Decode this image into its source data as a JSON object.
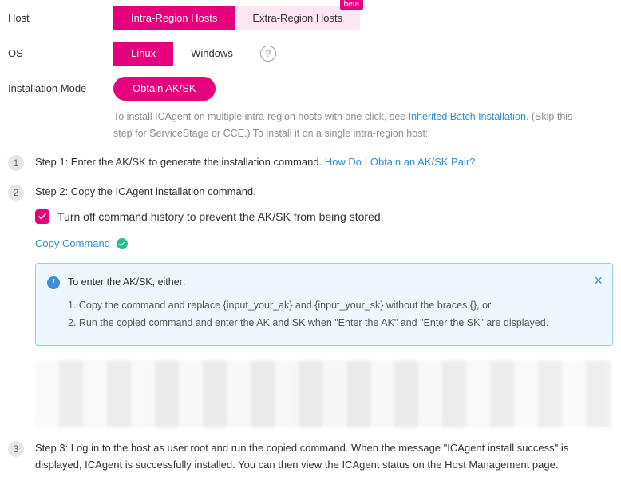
{
  "host": {
    "label": "Host",
    "options": [
      "Intra-Region Hosts",
      "Extra-Region Hosts"
    ],
    "beta_tag": "beta"
  },
  "os": {
    "label": "OS",
    "options": [
      "Linux",
      "Windows"
    ]
  },
  "mode": {
    "label": "Installation Mode",
    "button": "Obtain AK/SK",
    "hint_prefix": "To install ICAgent on multiple intra-region hosts with one click, see ",
    "hint_link": "Inherited Batch Installation",
    "hint_suffix": ". (Skip this step for ServiceStage or CCE.) To install it on a single intra-region host:"
  },
  "steps": {
    "s1": {
      "num": "1",
      "text": "Step 1: Enter the AK/SK to generate the installation command. ",
      "link": "How Do I Obtain an AK/SK Pair?"
    },
    "s2": {
      "num": "2",
      "text": "Step 2: Copy the ICAgent installation command.",
      "checkbox_label": "Turn off command history to prevent the AK/SK from being stored.",
      "copy_label": "Copy Command",
      "info_title": "To enter the AK/SK, either:",
      "info_line1": "1. Copy the command and replace {input_your_ak} and {input_your_sk} without the braces {}, or",
      "info_line2": "2. Run the copied command and enter the AK and SK when \"Enter the AK\" and \"Enter the SK\" are displayed."
    },
    "s3": {
      "num": "3",
      "text": "Step 3: Log in to the host as user root and run the copied command. When the message \"ICAgent install success\" is displayed, ICAgent is successfully installed. You can then view the ICAgent status on the Host Management page."
    }
  }
}
